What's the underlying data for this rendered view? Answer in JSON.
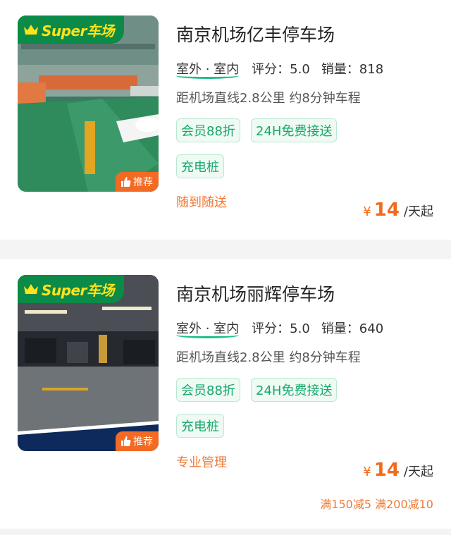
{
  "listings": [
    {
      "badge_text": "Super车场",
      "recommend_label": "推荐",
      "title": "南京机场亿丰停车场",
      "location_tag": "室外 · 室内",
      "score_label": "评分：5.0",
      "sales_label": "销量：818",
      "distance": "距机场直线2.8公里 约8分钟车程",
      "chips": [
        "会员88折",
        "24H免费接送",
        "充电桩"
      ],
      "note": "随到随送",
      "price_currency": "¥",
      "price_value": "14",
      "price_unit": "/天起"
    },
    {
      "badge_text": "Super车场",
      "recommend_label": "推荐",
      "title": "南京机场丽辉停车场",
      "location_tag": "室外 · 室内",
      "score_label": "评分：5.0",
      "sales_label": "销量：640",
      "distance": "距机场直线2.8公里 约8分钟车程",
      "chips": [
        "会员88折",
        "24H免费接送",
        "充电桩"
      ],
      "note": "专业管理",
      "price_currency": "¥",
      "price_value": "14",
      "price_unit": "/天起",
      "promo": "满150减5 满200减10"
    }
  ],
  "colors": {
    "brand_green": "#0b8a48",
    "chip_green": "#17a86a",
    "accent_orange": "#f26a1b"
  }
}
